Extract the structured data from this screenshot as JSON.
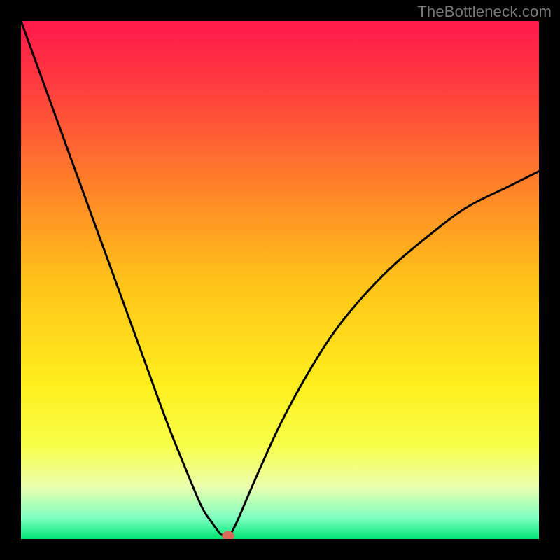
{
  "watermark": "TheBottleneck.com",
  "chart_data": {
    "type": "line",
    "title": "",
    "xlabel": "",
    "ylabel": "",
    "xlim": [
      0,
      100
    ],
    "ylim": [
      0,
      100
    ],
    "background": {
      "type": "vertical-gradient",
      "stops": [
        {
          "offset": 0.0,
          "color": "#ff1a4b"
        },
        {
          "offset": 0.12,
          "color": "#ff3a3f"
        },
        {
          "offset": 0.3,
          "color": "#ff7b2b"
        },
        {
          "offset": 0.5,
          "color": "#ffc21a"
        },
        {
          "offset": 0.7,
          "color": "#ffee1c"
        },
        {
          "offset": 0.82,
          "color": "#f7ff4a"
        },
        {
          "offset": 0.9,
          "color": "#eaffb0"
        },
        {
          "offset": 0.96,
          "color": "#7dffc0"
        },
        {
          "offset": 1.0,
          "color": "#00e673"
        }
      ]
    },
    "series": [
      {
        "name": "bottleneck-curve",
        "color": "#000000",
        "stroke_width": 3,
        "x": [
          0,
          4,
          8,
          12,
          16,
          20,
          24,
          28,
          32,
          35,
          37,
          38.5,
          39.5,
          40.5,
          42,
          45,
          50,
          56,
          62,
          70,
          78,
          86,
          94,
          100
        ],
        "y": [
          100,
          89,
          78,
          67,
          56,
          45,
          34,
          23,
          13,
          6,
          3,
          1,
          0.5,
          1,
          4,
          11,
          22,
          33,
          42,
          51,
          58,
          64,
          68,
          71
        ]
      }
    ],
    "marker": {
      "name": "optimum-marker",
      "x": 40,
      "y": 0.6,
      "rx": 1.2,
      "ry": 0.9,
      "color": "#d86a5a"
    }
  }
}
